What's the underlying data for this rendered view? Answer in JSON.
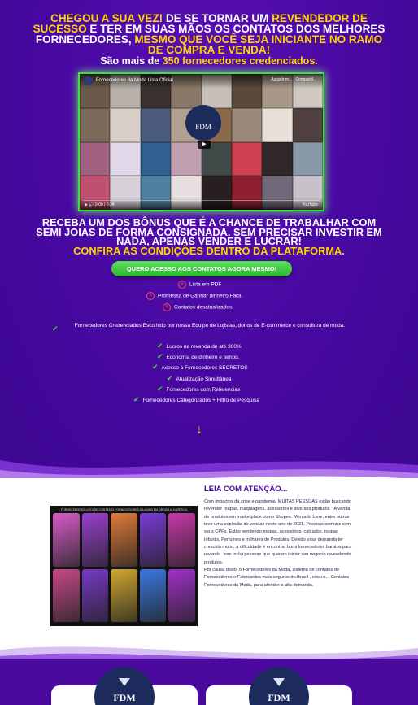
{
  "headline": {
    "p1": "CHEGOU A SUA VEZ!",
    "p2": " DE SE TORNAR UM ",
    "p3": "REVENDEDOR DE SUCESSO",
    "p4": " E TER EM SUAS MÃOS OS CONTATOS DOS MELHORES FORNECEDORES, ",
    "p5": "MESMO QUE VOCÊ SEJA INICIANTE NO RAMO DE COMPRA E VENDA!"
  },
  "subline": {
    "pre": "São mais de ",
    "highlight": "350 fornecedores credenciados."
  },
  "video": {
    "title": "Fornecedores da Moda Lista Oficial",
    "watch_later": "Assistir m...",
    "share": "Compartil...",
    "time": "0:00 / 0:34",
    "platform": "YouTube",
    "logo": "FDM",
    "tile_colors": [
      "#6a5a4a",
      "#b8b0a8",
      "#3a3030",
      "#8a7868",
      "#c8c0b8",
      "#5a4a3a",
      "#a89888",
      "#d0c8c0",
      "#7a6a5a",
      "#d8d0c8",
      "#4a5a7a",
      "#b0a090",
      "#8a6a4a",
      "#9a8a7a",
      "#e8e0d8",
      "#504040",
      "#a06080",
      "#e0d8e8",
      "#306090",
      "#c0a0b0",
      "#404848",
      "#d04050",
      "#302828",
      "#8898a8",
      "#c05070",
      "#d8d0d8",
      "#5080a0",
      "#e8e0e0",
      "#282020",
      "#902030",
      "#706878",
      "#c8c0c8"
    ]
  },
  "bonus": {
    "text": "RECEBA UM DOS BÔNUS QUE É A CHANCE DE TRABALHAR COM SEMI JOIAS DE FORMA CONSIGNADA. SEM PRECISAR INVESTIR EM NADA, APENAS VENDER E LUCRAR!",
    "highlight": "CONFIRA AS CONDIÇÕES DENTRO DA PLATAFORMA."
  },
  "cta_label": "QUERO ACESSO AOS CONTATOS AGORA MESMO!",
  "negatives": [
    "Lista em PDF",
    "Promessa de Ganhar dinheiro Fácil.",
    "Contatos desatualizados."
  ],
  "positives": [
    "Fornecedores Credenciados Escolhido por nossa Equipe de Lojistas, donos de E-commerce e consultora de moda.",
    "Lucros na revenda de até 300%",
    "Economia de dinheiro e tempo.",
    "Acesso à Fornecedores SECRETOS",
    "Atualização Simultânea",
    "Fornecedores com Referencias",
    "Fornecedores Categorizados + Filtro de Pesquisa"
  ],
  "arrow": "↓",
  "read": {
    "title": "LEIA COM ATENÇÃO...",
    "body": "Com impactos da crise e pandemia, MUITAS PESSOAS estão buscando revender roupas, maquiagens, acessórios e diversos produtos \" A venda de produtos em marketplace como Shopee, Mercado Livre, entre outros teve uma explosão de vendas neste ano de 2021, Pessoas comuns com seus CPFs. Estão vendendo roupas, acessórios, calçados, roupas Infantis, Perfumes e milhares de Produtos. Devido essa demanda ter crescido muito, a dificuldade é encontrar bons fornecedores baratos para revenda. Isso inclui pessoas que querem iniciar seu negocio revendendo produtos.",
    "body2": "Por causa disso, o Fornecedores da Moda, sistema de contatos de Fornecedores e Fabricantes mais seguros do Brasil , criou o... Contatos Fornecedores da Moda, para atender a alta demanda."
  },
  "thumb": {
    "banner": "FORNECEDORES LISTA DE CONTATOS FORNECEDORES DA MODA EM ORDEM ALFABÉTICA",
    "tile_colors": [
      "#d85cc8",
      "#9a40d0",
      "#e07a3a",
      "#7a3ad8",
      "#c838a8",
      "#c84888",
      "#7838c8",
      "#d0a830",
      "#3a78e0",
      "#a030c8"
    ]
  },
  "badges": [
    "FDM",
    "FDM"
  ],
  "colors": {
    "purple": "#4a0a9e",
    "yellow": "#ffd600",
    "green": "#3de03d",
    "red": "#ff4a4a"
  }
}
